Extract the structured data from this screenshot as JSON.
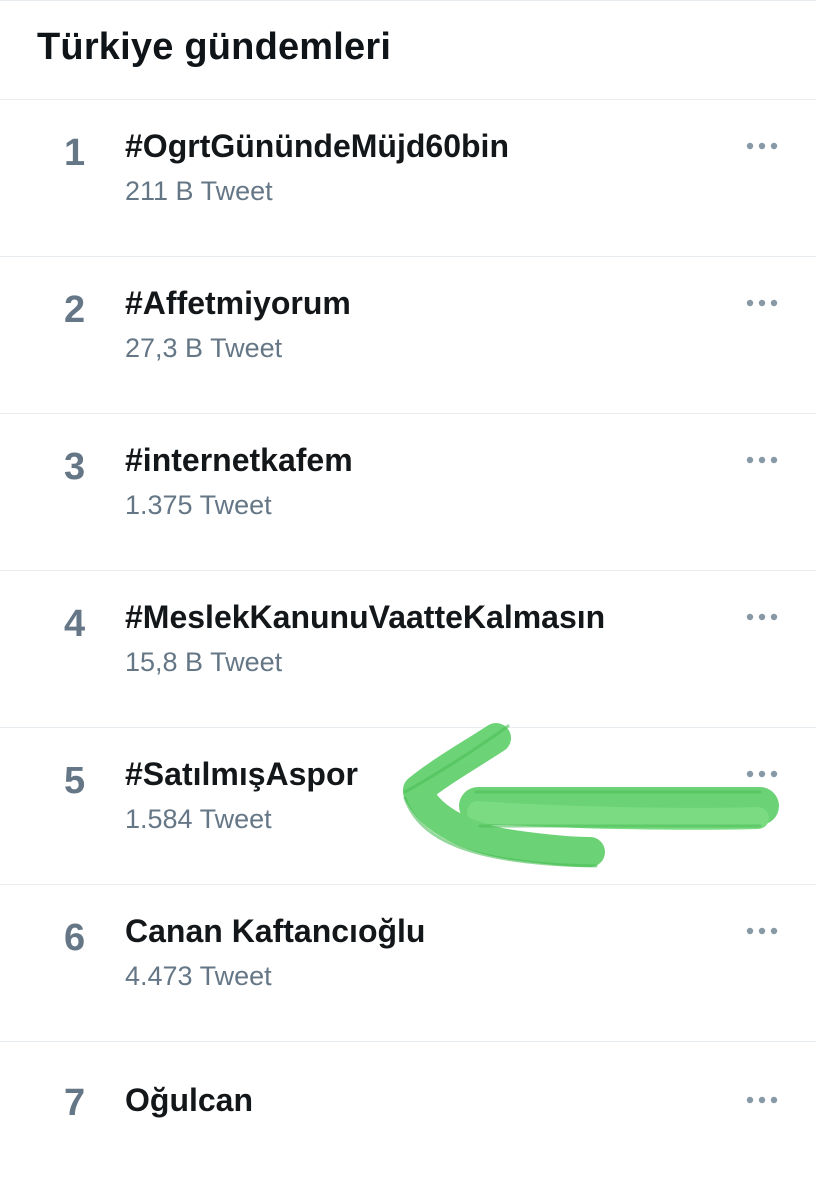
{
  "header": {
    "title": "Türkiye gündemleri"
  },
  "trends": [
    {
      "rank": "1",
      "name": "#OgrtGünündeMüjd60bin",
      "count": "211 B Tweet"
    },
    {
      "rank": "2",
      "name": "#Affetmiyorum",
      "count": "27,3 B Tweet"
    },
    {
      "rank": "3",
      "name": "#internetkafem",
      "count": "1.375 Tweet"
    },
    {
      "rank": "4",
      "name": "#MeslekKanunuVaatteKalmasın",
      "count": "15,8 B Tweet"
    },
    {
      "rank": "5",
      "name": "#SatılmışAspor",
      "count": "1.584 Tweet"
    },
    {
      "rank": "6",
      "name": "Canan Kaftancıoğlu",
      "count": "4.473 Tweet"
    },
    {
      "rank": "7",
      "name": "Oğulcan",
      "count": ""
    }
  ],
  "icons": {
    "more": "more-horizontal-icon",
    "annotation": "green-arrow-annotation"
  },
  "colors": {
    "text_primary": "#14171a",
    "text_secondary": "#657786",
    "divider": "#e6ecf0",
    "annotation": "#5fcf6a"
  }
}
